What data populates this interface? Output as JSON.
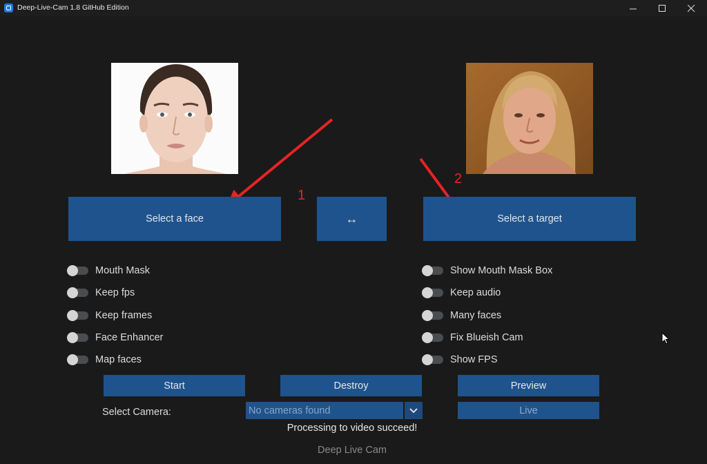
{
  "window": {
    "title": "Deep-Live-Cam 1.8 GitHub Edition",
    "controls": [
      "minimize-icon",
      "maximize-icon",
      "close-icon"
    ]
  },
  "images": {
    "source_face": "source-face-photo",
    "target": "target-photo"
  },
  "annotations": {
    "num1": "1",
    "num2": "2",
    "arrow_color": "#e82424"
  },
  "buttons": {
    "select_face": "Select a face",
    "swap": "↔",
    "select_target": "Select a target",
    "start": "Start",
    "destroy": "Destroy",
    "preview": "Preview",
    "live": "Live"
  },
  "switches_left": [
    {
      "label": "Mouth Mask",
      "on": false
    },
    {
      "label": "Keep fps",
      "on": false
    },
    {
      "label": "Keep frames",
      "on": false
    },
    {
      "label": "Face Enhancer",
      "on": false
    },
    {
      "label": "Map faces",
      "on": false
    }
  ],
  "switches_right": [
    {
      "label": "Show Mouth Mask Box",
      "on": false
    },
    {
      "label": "Keep audio",
      "on": false
    },
    {
      "label": "Many faces",
      "on": false
    },
    {
      "label": "Fix Blueish Cam",
      "on": false
    },
    {
      "label": "Show FPS",
      "on": false
    }
  ],
  "camera": {
    "label": "Select Camera:",
    "value": "No cameras found"
  },
  "status": "Processing to video succeed!",
  "footer": "Deep Live Cam",
  "colors": {
    "background": "#1a1a1a",
    "button": "#1f538d",
    "switch_track": "#4a4d50",
    "switch_knob": "#d5d5d5"
  }
}
